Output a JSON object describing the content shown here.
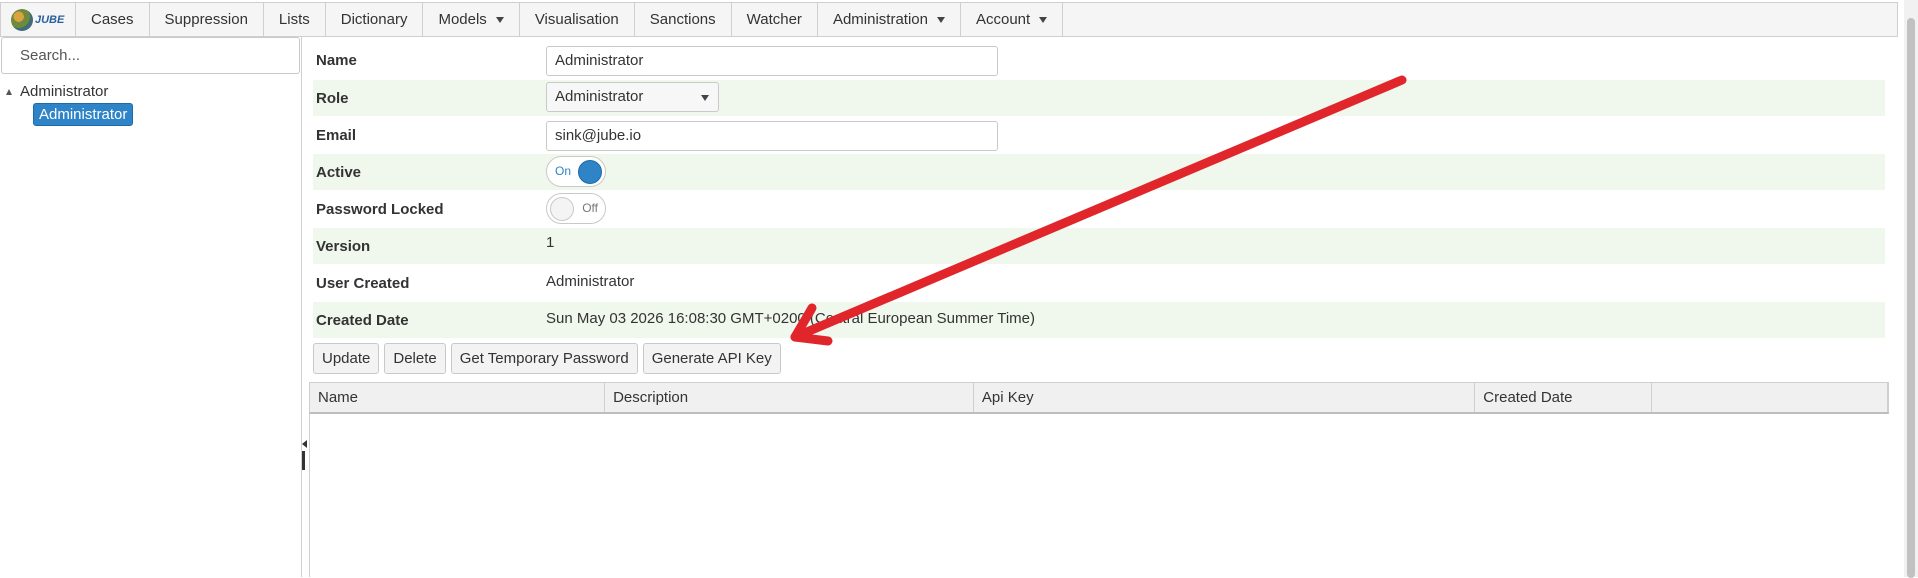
{
  "nav": {
    "logo_text": "JUBE",
    "items": [
      {
        "label": "Cases",
        "dropdown": false
      },
      {
        "label": "Suppression",
        "dropdown": false
      },
      {
        "label": "Lists",
        "dropdown": false
      },
      {
        "label": "Dictionary",
        "dropdown": false
      },
      {
        "label": "Models",
        "dropdown": true
      },
      {
        "label": "Visualisation",
        "dropdown": false
      },
      {
        "label": "Sanctions",
        "dropdown": false
      },
      {
        "label": "Watcher",
        "dropdown": false
      },
      {
        "label": "Administration",
        "dropdown": true
      },
      {
        "label": "Account",
        "dropdown": true
      }
    ]
  },
  "sidebar": {
    "search_placeholder": "Search...",
    "tree": {
      "parent": "Administrator",
      "children": [
        "Administrator"
      ]
    }
  },
  "form": {
    "name_label": "Name",
    "name_value": "Administrator",
    "role_label": "Role",
    "role_value": "Administrator",
    "email_label": "Email",
    "email_value": "sink@jube.io",
    "active_label": "Active",
    "active_state": "On",
    "password_locked_label": "Password Locked",
    "password_locked_state": "Off",
    "version_label": "Version",
    "version_value": "1",
    "user_created_label": "User Created",
    "user_created_value": "Administrator",
    "created_date_label": "Created Date",
    "created_date_value": "Sun May 03 2026 16:08:30 GMT+0200 (Central European Summer Time)"
  },
  "actions": {
    "update": "Update",
    "delete": "Delete",
    "temp_password": "Get Temporary Password",
    "generate_api_key": "Generate API Key"
  },
  "grid": {
    "columns": [
      "Name",
      "Description",
      "Api Key",
      "Created Date",
      ""
    ]
  },
  "colors": {
    "accent": "#2f84c8",
    "row_shade": "#f0f7ec",
    "annotation_arrow": "#e0262b"
  }
}
